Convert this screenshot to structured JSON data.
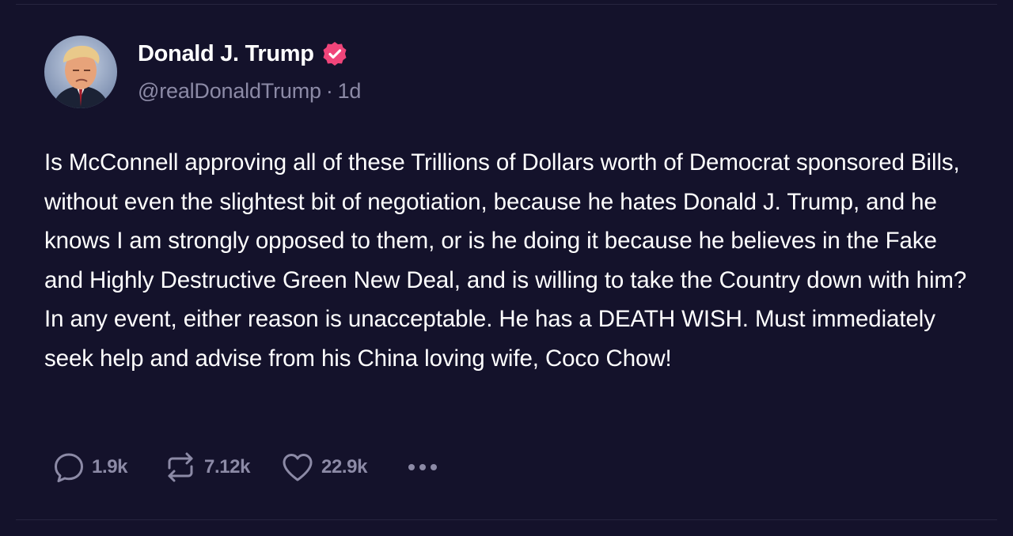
{
  "post": {
    "author": {
      "display_name": "Donald J. Trump",
      "handle": "@realDonaldTrump",
      "separator": "·",
      "time_ago": "1d",
      "verified": true,
      "verified_color": "#f0457a"
    },
    "text": "Is McConnell approving all of these Trillions of Dollars worth of Democrat sponsored Bills, without even the slightest bit of negotiation, because he hates Donald J. Trump, and he knows I am strongly opposed to them, or is he doing it because he believes in the Fake and Highly Destructive Green New Deal, and is willing to take the Country down with him? In any event, either reason is unacceptable. He has a DEATH WISH. Must immediately seek help and advise from his China loving wife, Coco Chow!",
    "actions": {
      "replies": "1.9k",
      "reposts": "7.12k",
      "likes": "22.9k",
      "reply_icon": "speech-bubble-icon",
      "repost_icon": "repost-arrows-icon",
      "like_icon": "heart-icon",
      "more_icon": "more-dots-icon"
    }
  },
  "colors": {
    "background": "#14122b",
    "text": "#ffffff",
    "muted": "#8c8aa6",
    "divider": "#26243f"
  }
}
